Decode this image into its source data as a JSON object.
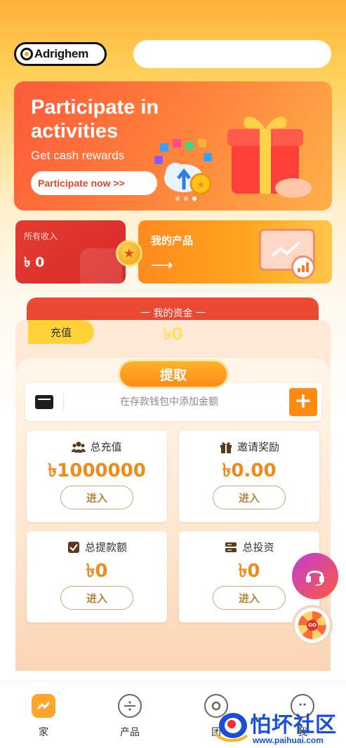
{
  "header": {
    "logo_text": "Adrighem"
  },
  "banner": {
    "title_line1": "Participate in",
    "title_line2": "activities",
    "subtitle": "Get cash rewards",
    "button": "Participate now >>"
  },
  "income": {
    "label": "所有收入",
    "value": "৳ 0"
  },
  "my_product": {
    "title": "我的产品",
    "arrow": "⟶"
  },
  "funds": {
    "label": "一  我的资金  一",
    "value": "৳0",
    "recharge": "充值",
    "withdraw": "提取"
  },
  "wallet": {
    "placeholder": "在存款钱包中添加金额",
    "plus": "+"
  },
  "stats": [
    {
      "label": "总充值",
      "value": "৳1000000",
      "button": "进入",
      "icon": "users-icon"
    },
    {
      "label": "邀请奖励",
      "value": "৳0.00",
      "button": "进入",
      "icon": "gift-icon"
    },
    {
      "label": "总提款额",
      "value": "৳0",
      "button": "进入",
      "icon": "checkbox-icon"
    },
    {
      "label": "总投资",
      "value": "৳0",
      "button": "进入",
      "icon": "server-icon"
    }
  ],
  "nav": [
    {
      "label": "家",
      "icon": "home-chart-icon",
      "active": true
    },
    {
      "label": "产品",
      "icon": "product-icon",
      "active": false
    },
    {
      "label": "团",
      "icon": "team-icon",
      "active": false
    },
    {
      "label": "我",
      "icon": "face-icon",
      "active": false
    }
  ],
  "watermark": {
    "text": "怕坏社区",
    "url": "www.paihuai.com"
  },
  "colors": {
    "primary": "#ff8a14",
    "accent_red": "#e2452b",
    "gold": "#ffd23a"
  }
}
